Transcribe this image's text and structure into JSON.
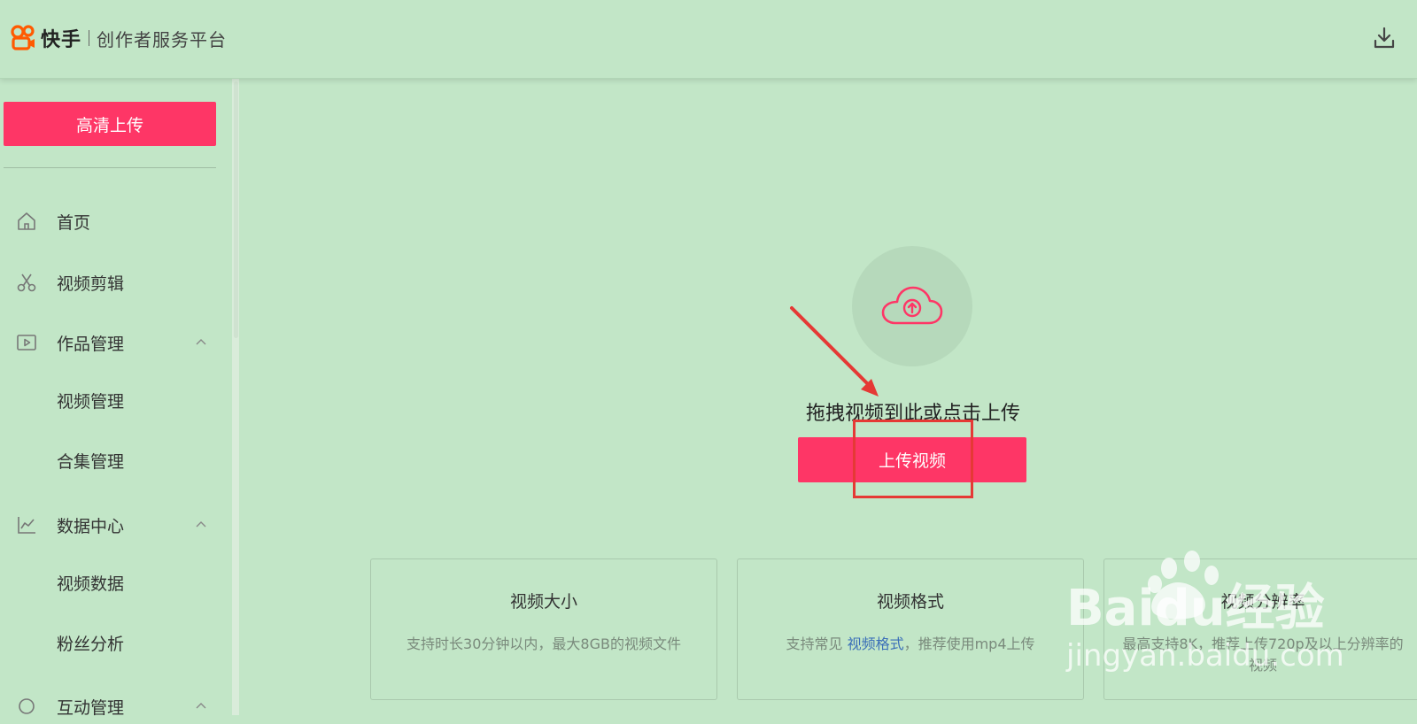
{
  "header": {
    "brand": "快手",
    "platform": "创作者服务平台"
  },
  "sidebar": {
    "hd_upload_label": "高清上传",
    "items": [
      {
        "label": "首页",
        "icon": "home-icon"
      },
      {
        "label": "视频剪辑",
        "icon": "scissors-icon"
      },
      {
        "label": "作品管理",
        "icon": "play-square-icon",
        "expanded": true
      },
      {
        "label": "视频管理"
      },
      {
        "label": "合集管理"
      },
      {
        "label": "数据中心",
        "icon": "line-chart-icon",
        "expanded": true
      },
      {
        "label": "视频数据"
      },
      {
        "label": "粉丝分析"
      },
      {
        "label": "互动管理",
        "icon": "interaction-icon"
      }
    ]
  },
  "upload": {
    "drop_text": "拖拽视频到此或点击上传",
    "button_label": "上传视频"
  },
  "cards": [
    {
      "title": "视频大小",
      "desc": "支持时长30分钟以内，最大8GB的视频文件"
    },
    {
      "title": "视频格式",
      "desc_prefix": "支持常见 ",
      "desc_link": "视频格式",
      "desc_suffix": "，推荐使用mp4上传"
    },
    {
      "title": "视频分辨率",
      "desc": "最高支持8K，推荐上传720p及以上分辨率的视频"
    }
  ],
  "watermark": {
    "logo_text": "Baidu经验",
    "url": "jingyan.baidu.com"
  },
  "colors": {
    "background": "#c2e6c7",
    "primary": "#fe3666",
    "annotation_red": "#e53935",
    "link": "#3b6fb8"
  }
}
